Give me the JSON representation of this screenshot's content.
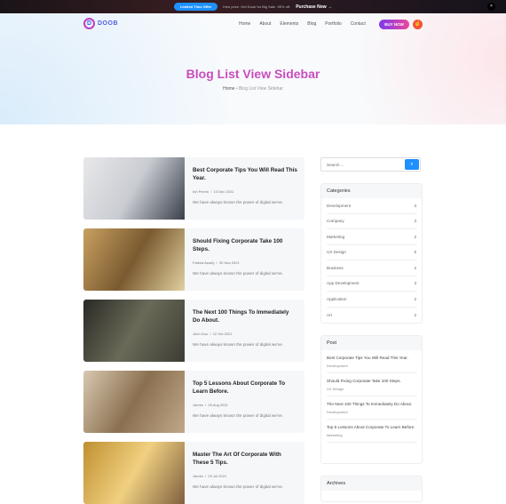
{
  "topbar": {
    "offer": "Limited Time Offer",
    "text": "Intro price. Get Doob for Big Sale -95% off.",
    "purchase": "Purchase Now →",
    "close": "×"
  },
  "nav": {
    "logo_mark": "D",
    "logo": "DOOB",
    "items": [
      "Home",
      "About",
      "Elements",
      "Blog",
      "Portfolio",
      "Contact"
    ],
    "buy": "BUY NOW",
    "hand_icon": "☝"
  },
  "hero": {
    "title": "Blog List View Sidebar",
    "crumb_home": "Home",
    "crumb_sep": "•",
    "crumb_current": "Blog List View Sidebar"
  },
  "posts": [
    {
      "title": "Best Corporate Tips You Will Read This Year.",
      "author": "Irin Pervin",
      "date": "10 Dec 2021",
      "excerpt": "We have always known the power of digital we've."
    },
    {
      "title": "Should Fixing Corporate Take 100 Steps.",
      "author": "Fatima Asrafy",
      "date": "30 Nov 2021",
      "excerpt": "We have always known the power of digital we've."
    },
    {
      "title": "The Next 100 Things To Immediately Do About.",
      "author": "John Dou",
      "date": "12 Oct 2021",
      "excerpt": "We have always known the power of digital we've."
    },
    {
      "title": "Top 5 Lessons About Corporate To Learn Before.",
      "author": "Jannin",
      "date": "25 Aug 2021",
      "excerpt": "We have always known the power of digital we've."
    },
    {
      "title": "Master The Art Of Corporate With These 5 Tips.",
      "author": "Jannin",
      "date": "23 Jul 2021",
      "excerpt": "We have always known the power of digital we've."
    }
  ],
  "sidebar": {
    "search_placeholder": "Search ...",
    "search_icon": "⌕",
    "categories_title": "Categories",
    "categories": [
      {
        "name": "Development",
        "count": "3"
      },
      {
        "name": "Company",
        "count": "3"
      },
      {
        "name": "Marketing",
        "count": "2"
      },
      {
        "name": "UX Design",
        "count": "5"
      },
      {
        "name": "Business",
        "count": "2"
      },
      {
        "name": "App Development",
        "count": "3"
      },
      {
        "name": "Application",
        "count": "2"
      },
      {
        "name": "Art",
        "count": "2"
      }
    ],
    "post_title": "Post",
    "recent": [
      {
        "title": "Best Corporate Tips You Will Read This Year.",
        "cat": "Development"
      },
      {
        "title": "Should Fixing Corporate Take 100 Steps.",
        "cat": "UX Design"
      },
      {
        "title": "The Next 100 Things To Immediately Do About.",
        "cat": "Development"
      },
      {
        "title": "Top 5 Lessons About Corporate To Learn Before.",
        "cat": "Marketing"
      }
    ],
    "archives_title": "Archives"
  }
}
